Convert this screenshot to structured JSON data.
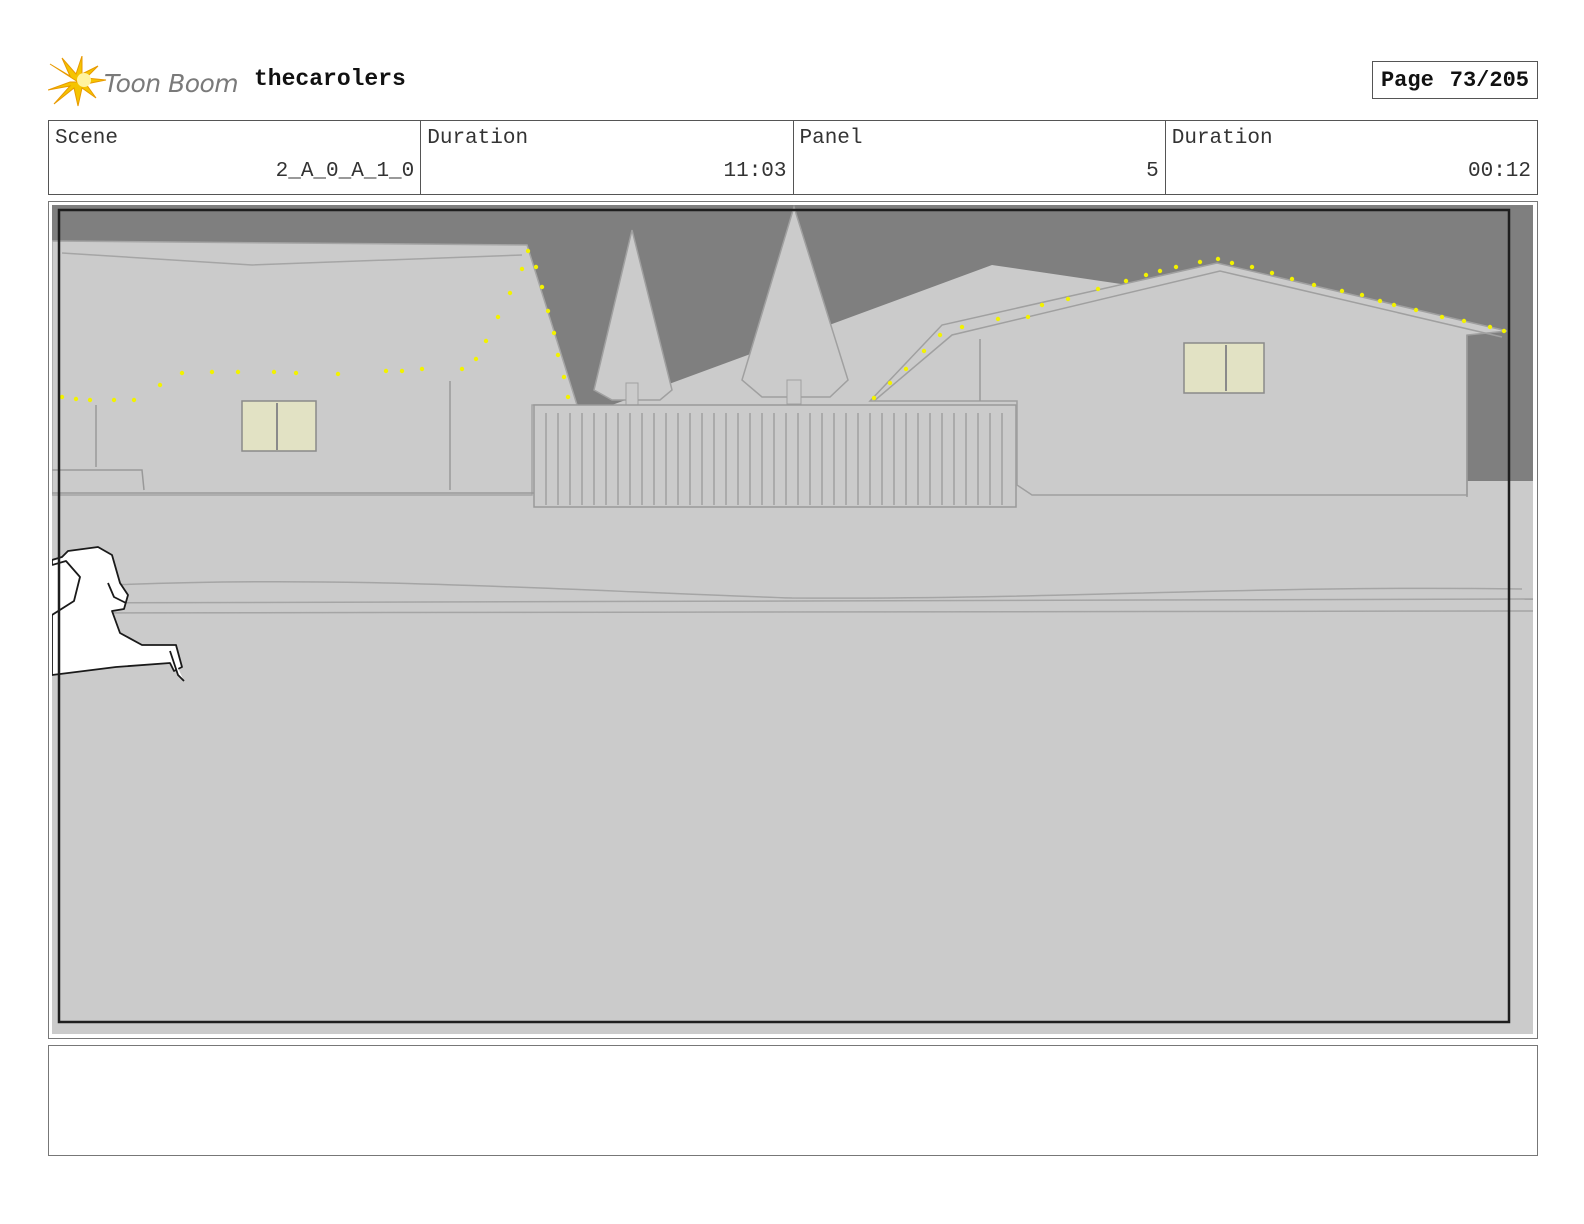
{
  "header": {
    "logo_text": "Toon Boom",
    "project_title": "thecarolers",
    "page_label": "Page",
    "page_number": "73/205"
  },
  "info": {
    "scene_label": "Scene",
    "scene_value": "2_A_0_A_1_0",
    "scene_duration_label": "Duration",
    "scene_duration_value": "11:03",
    "panel_label": "Panel",
    "panel_value": "5",
    "panel_duration_label": "Duration",
    "panel_duration_value": "00:12"
  },
  "panel_image": {
    "description_icon": "storyboard-drawing",
    "colors": {
      "sky": "#7f7f7f",
      "ground": "#cbcbcb",
      "lights": "#f2f200",
      "window": "#e2e2c4"
    }
  },
  "notes": {
    "text": ""
  }
}
